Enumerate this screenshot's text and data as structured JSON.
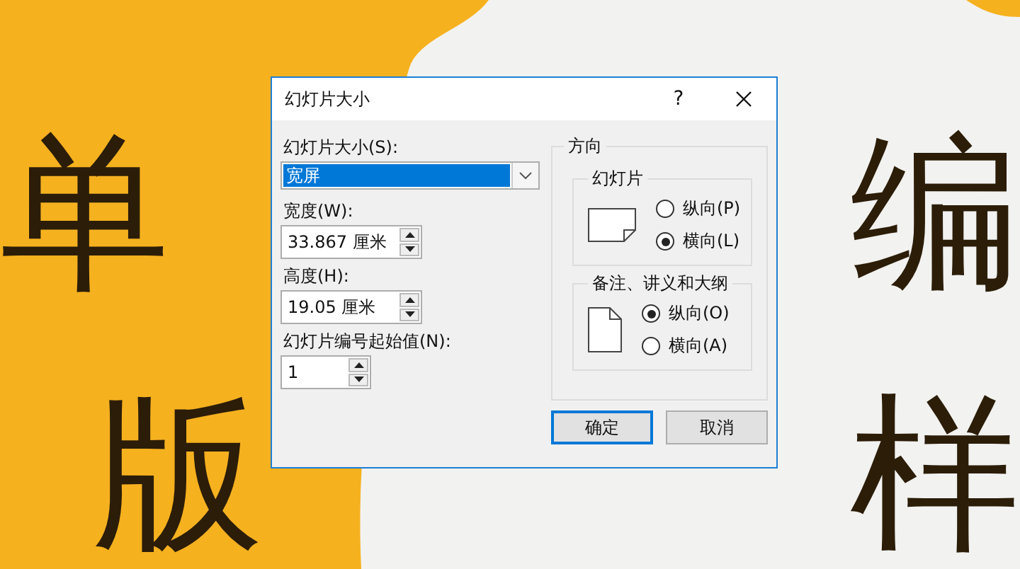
{
  "slide": {
    "title_line_1": [
      "单",
      "编"
    ],
    "title_line_2": [
      "版",
      "样"
    ]
  },
  "dialog": {
    "title": "幻灯片大小",
    "help": "?",
    "slide_size": {
      "label": "幻灯片大小(S):",
      "value": "宽屏"
    },
    "fields": [
      {
        "label": "宽度(W):",
        "value": "33.867 厘米",
        "kind": "wide"
      },
      {
        "label": "高度(H):",
        "value": "19.05 厘米",
        "kind": "wide"
      },
      {
        "label": "幻灯片编号起始值(N):",
        "value": "1",
        "kind": "narrow"
      }
    ],
    "orientation": {
      "title": "方向",
      "groups": [
        {
          "title": "幻灯片",
          "kind": "landscape",
          "options": [
            {
              "label": "纵向(P)",
              "selected": false
            },
            {
              "label": "横向(L)",
              "selected": true
            }
          ]
        },
        {
          "title": "备注、讲义和大纲",
          "kind": "portrait",
          "options": [
            {
              "label": "纵向(O)",
              "selected": true
            },
            {
              "label": "横向(A)",
              "selected": false
            }
          ]
        }
      ]
    },
    "buttons": [
      {
        "label": "确定",
        "default": true
      },
      {
        "label": "取消",
        "default": false
      }
    ]
  }
}
